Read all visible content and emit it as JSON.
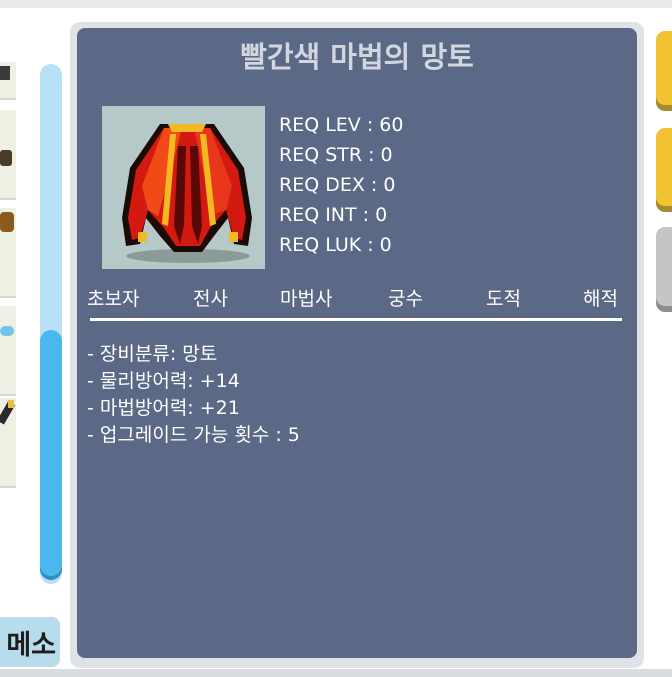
{
  "tooltip": {
    "title": "빨간색 마법의 망토",
    "item_icon": "red-magic-cape-sprite",
    "requirements": [
      "REQ LEV : 60",
      "REQ STR : 0",
      "REQ DEX : 0",
      "REQ INT : 0",
      "REQ LUK : 0"
    ],
    "jobs": [
      "초보자",
      "전사",
      "마법사",
      "궁수",
      "도적",
      "해적"
    ],
    "stats": [
      "- 장비분류: 망토",
      "- 물리방어력: +14",
      "- 마법방어력: +21",
      "- 업그레이드 가능 횟수 : 5"
    ]
  },
  "inventory": {
    "meso_label": "메소",
    "scroll_icon": "scrollbar"
  },
  "colors": {
    "panel_bg": "#5b6886",
    "title": "#d2d6de",
    "tab_yellow": "#f1c232",
    "tab_gray": "#c3c5c7",
    "scroll_thumb": "#4ab8ee"
  }
}
